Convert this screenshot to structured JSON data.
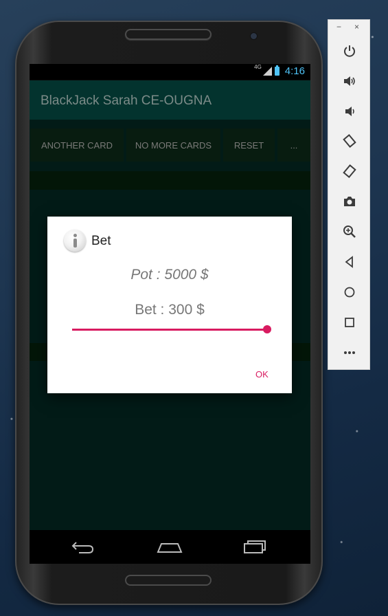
{
  "status_bar": {
    "network": "4G",
    "time": "4:16"
  },
  "app_bar": {
    "title": "BlackJack Sarah CE-OUGNA"
  },
  "action_buttons": [
    {
      "label": "ANOTHER CARD"
    },
    {
      "label": "NO MORE CARDS"
    },
    {
      "label": "RESET"
    },
    {
      "label": "..."
    }
  ],
  "dialog": {
    "title": "Bet",
    "icon": "info-icon",
    "pot_text": "Pot : 5000 $",
    "bet_text": "Bet : 300 $",
    "slider_value_fraction": 1.0,
    "ok_label": "OK"
  },
  "nav_bar": {
    "icons": [
      "back-icon",
      "home-icon",
      "recents-icon"
    ]
  },
  "emulator_toolbar": {
    "window_controls": [
      "minimize-icon",
      "close-icon"
    ],
    "minimize_symbol": "−",
    "close_symbol": "×",
    "buttons": [
      "power-icon",
      "volume-up-icon",
      "volume-down-icon",
      "rotate-left-icon",
      "rotate-right-icon",
      "camera-icon",
      "zoom-icon",
      "back-icon",
      "home-icon",
      "overview-icon",
      "more-icon"
    ]
  },
  "colors": {
    "accent": "#d81b60",
    "app_bar": "#03332e",
    "status_clock": "#4fc3f7"
  }
}
